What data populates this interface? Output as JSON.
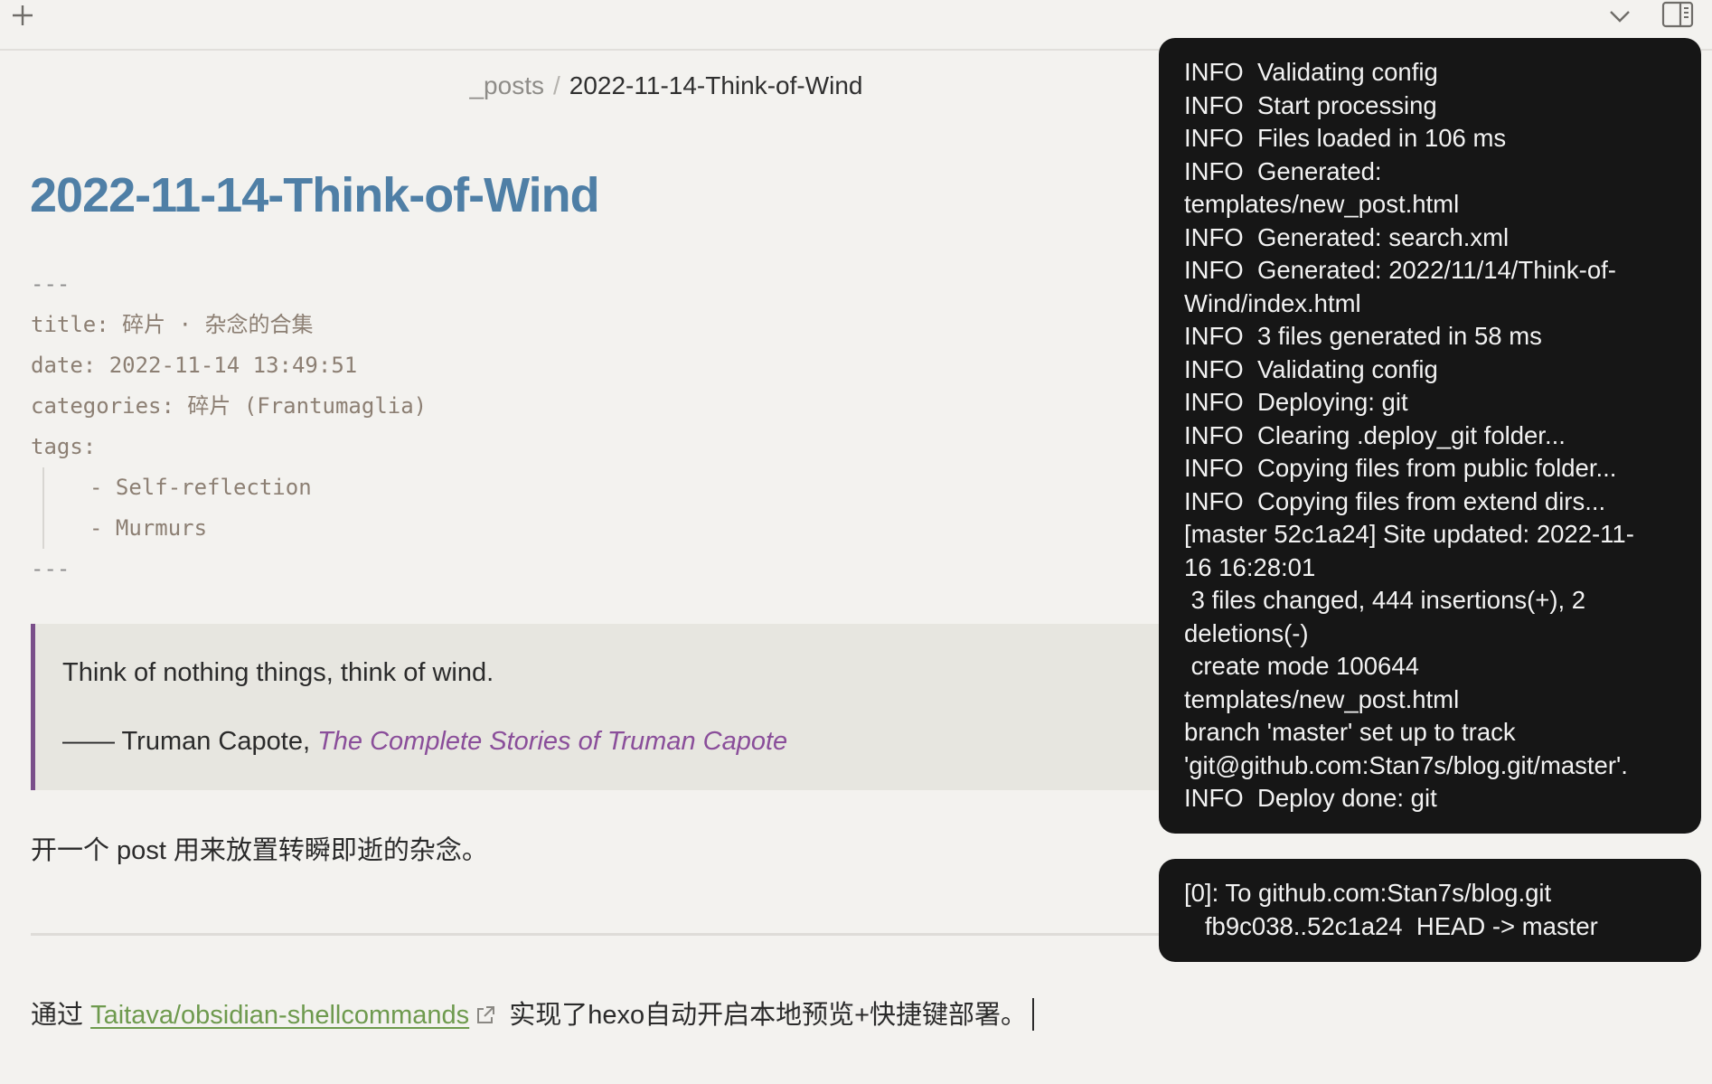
{
  "toolbar": {
    "new_tab_icon": "plus-icon",
    "tabs_menu_icon": "chevron-down-icon",
    "sidebar_toggle_icon": "sidebar-right-icon"
  },
  "breadcrumb": {
    "folder": "_posts",
    "separator": "/",
    "file": "2022-11-14-Think-of-Wind"
  },
  "view_actions": {
    "reading_icon": "book-open-icon",
    "more_icon": "more-vertical-icon"
  },
  "note": {
    "title": "2022-11-14-Think-of-Wind",
    "frontmatter": {
      "open_delim": "---",
      "title_line": "title: 碎片 · 杂念的合集",
      "date_line": "date: 2022-11-14 13:49:51",
      "categories_line": "categories: 碎片 (Frantumaglia)",
      "tags_line": "tags:",
      "tags": [
        "- Self-reflection",
        "- Murmurs"
      ],
      "close_delim": "---"
    },
    "quote": {
      "text": "Think of nothing things, think of wind.",
      "attribution_prefix": "—— Truman Capote, ",
      "book": "The Complete Stories of Truman Capote"
    },
    "paragraph1": "开一个 post 用来放置转瞬即逝的杂念。",
    "paragraph2": {
      "prefix": "通过 ",
      "link_text": "Taitava/obsidian-shellcommands",
      "suffix": " 实现了hexo自动开启本地预览+快捷键部署。"
    }
  },
  "notifications": {
    "log_lines": [
      "INFO  Validating config",
      "INFO  Start processing",
      "INFO  Files loaded in 106 ms",
      "INFO  Generated:",
      "templates/new_post.html",
      "INFO  Generated: search.xml",
      "INFO  Generated: 2022/11/14/Think-of-",
      "Wind/index.html",
      "INFO  3 files generated in 58 ms",
      "INFO  Validating config",
      "INFO  Deploying: git",
      "INFO  Clearing .deploy_git folder...",
      "INFO  Copying files from public folder...",
      "INFO  Copying files from extend dirs...",
      "[master 52c1a24] Site updated: 2022-11-",
      "16 16:28:01",
      " 3 files changed, 444 insertions(+), 2",
      "deletions(-)",
      " create mode 100644",
      "templates/new_post.html",
      "branch 'master' set up to track",
      "'git@github.com:Stan7s/blog.git/master'.",
      "INFO  Deploy done: git"
    ],
    "push_lines": [
      "[0]: To github.com:Stan7s/blog.git",
      "   fb9c038..52c1a24  HEAD -> master"
    ]
  }
}
